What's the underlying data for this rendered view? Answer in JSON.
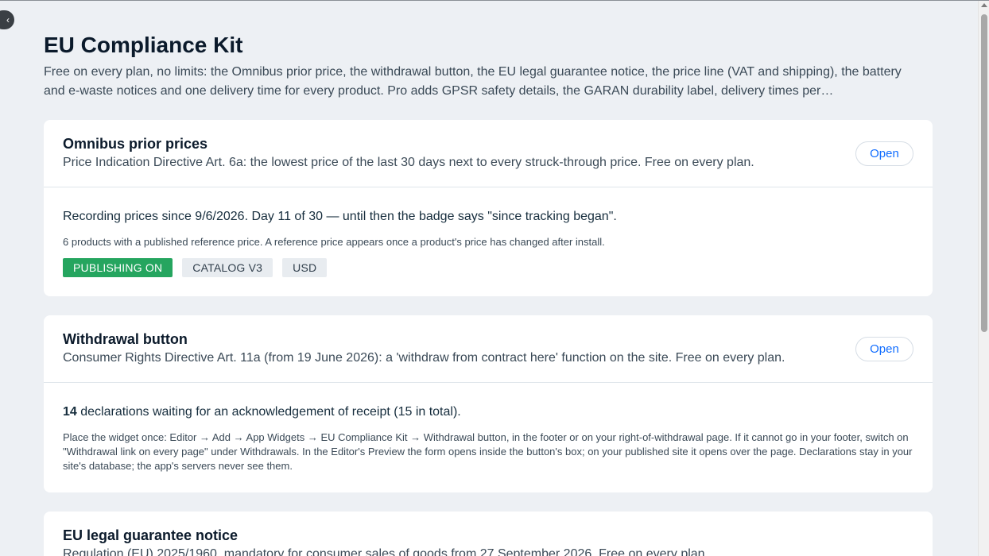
{
  "page": {
    "title": "EU Compliance Kit",
    "description": "Free on every plan, no limits: the Omnibus prior price, the withdrawal button, the EU legal guarantee notice, the price line (VAT and shipping), the battery and e-waste notices and one delivery time for every product. Pro adds GPSR safety details, the GARAN durability label, delivery times per…"
  },
  "cards": {
    "omnibus": {
      "title": "Omnibus prior prices",
      "subtitle": "Price Indication Directive Art. 6a: the lowest price of the last 30 days next to every struck-through price. Free on every plan.",
      "open_label": "Open",
      "status": "Recording prices since 9/6/2026. Day 11 of 30 — until then the badge says \"since tracking began\".",
      "note": "6 products with a published reference price. A reference price appears once a product's price has changed after install.",
      "badges": [
        "PUBLISHING ON",
        "CATALOG V3",
        "USD"
      ]
    },
    "withdrawal": {
      "title": "Withdrawal button",
      "subtitle": "Consumer Rights Directive Art. 11a (from 19 June 2026): a 'withdraw from contract here' function on the site. Free on every plan.",
      "open_label": "Open",
      "pending_count": "14",
      "status_rest": " declarations waiting for an acknowledgement of receipt (15 in total).",
      "note": "Place the widget once: Editor → Add → App Widgets → EU Compliance Kit → Withdrawal button, in the footer or on your right-of-withdrawal page. If it cannot go in your footer, switch on \"Withdrawal link on every page\" under Withdrawals. In the Editor's Preview the form opens inside the button's box; on your published site it opens over the page. Declarations stay in your site's database; the app's servers never see them."
    },
    "guarantee": {
      "title": "EU legal guarantee notice",
      "subtitle": "Regulation (EU) 2025/1960, mandatory for consumer sales of goods from 27 September 2026. Free on every plan."
    }
  },
  "colors": {
    "background": "#edf0f4",
    "accent": "#116dff",
    "status_green": "#25a55f"
  }
}
